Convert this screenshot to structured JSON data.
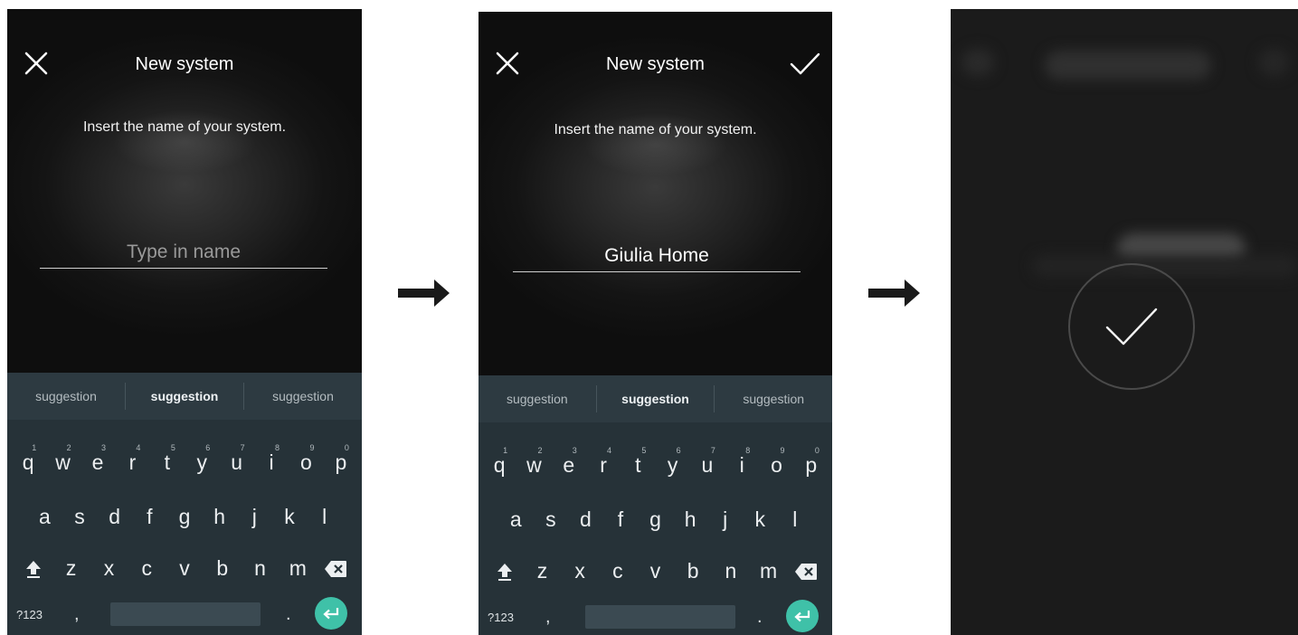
{
  "screens": [
    {
      "title": "New system",
      "instruction": "Insert the name of your system.",
      "input": {
        "value": "",
        "placeholder": "Type in name"
      },
      "suggestions": [
        "suggestion",
        "suggestion",
        "suggestion"
      ],
      "has_confirm": false
    },
    {
      "title": "New system",
      "instruction": "Insert the name of your system.",
      "input": {
        "value": "Giulia Home",
        "placeholder": "Type in name"
      },
      "suggestions": [
        "suggestion",
        "suggestion",
        "suggestion"
      ],
      "has_confirm": true
    }
  ],
  "keyboard": {
    "row1": [
      "q",
      "w",
      "e",
      "r",
      "t",
      "y",
      "u",
      "i",
      "o",
      "p"
    ],
    "row1_hints": [
      "1",
      "2",
      "3",
      "4",
      "5",
      "6",
      "7",
      "8",
      "9",
      "0"
    ],
    "row2": [
      "a",
      "s",
      "d",
      "f",
      "g",
      "h",
      "j",
      "k",
      "l"
    ],
    "row3": [
      "z",
      "x",
      "c",
      "v",
      "b",
      "n",
      "m"
    ],
    "symbols": "?123",
    "comma": ",",
    "period": "."
  },
  "colors": {
    "keyboard_bg": "#263238",
    "suggestion_bar": "#2d3a41",
    "enter_key": "#3fc1a8",
    "success_bg": "#1b1b1b"
  },
  "icons": {
    "close": "close-icon",
    "confirm": "check-icon",
    "shift": "shift-icon",
    "backspace": "backspace-icon",
    "enter": "enter-icon",
    "arrow": "arrow-right-icon",
    "success": "check-icon"
  }
}
